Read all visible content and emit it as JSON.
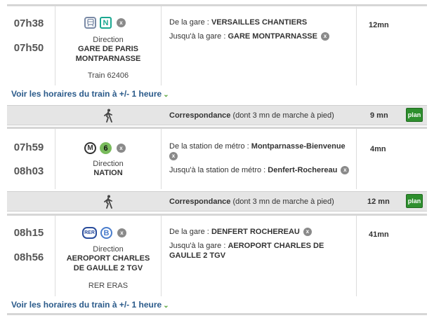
{
  "legs": [
    {
      "depart": "07h38",
      "arrive": "07h50",
      "direction_label": "Direction",
      "direction": "GARE DE PARIS MONTPARNASSE",
      "train_info": "Train 62406",
      "from_prefix": "De la gare :",
      "from": "VERSAILLES CHANTIERS",
      "to_prefix": "Jusqu'à la gare :",
      "to": "GARE MONTPARNASSE",
      "duration": "12mn",
      "line_badge": "N",
      "icons": [
        "train-icon",
        "transilien-n-icon",
        "close-icon"
      ]
    },
    {
      "depart": "07h59",
      "arrive": "08h03",
      "direction_label": "Direction",
      "direction": "NATION",
      "from_prefix": "De la station de métro :",
      "from": "Montparnasse-Bienvenue",
      "to_prefix": "Jusqu'à  la station de métro :",
      "to": "Denfert-Rochereau",
      "duration": "4mn",
      "mode_badge": "M",
      "line_badge": "6",
      "icons": [
        "metro-icon",
        "metro-line-6-icon",
        "close-icon"
      ]
    },
    {
      "depart": "08h15",
      "arrive": "08h56",
      "direction_label": "Direction",
      "direction": "AEROPORT CHARLES DE GAULLE 2 TGV",
      "train_info": "RER ERAS",
      "from_prefix": "De la gare :",
      "from": "DENFERT ROCHEREAU",
      "to_prefix": "Jusqu'à la gare :",
      "to": "AEROPORT CHARLES DE GAULLE 2 TGV",
      "duration": "41mn",
      "mode_badge": "RER",
      "line_badge": "B",
      "icons": [
        "rer-icon",
        "rer-line-b-icon",
        "close-icon"
      ]
    }
  ],
  "transfers": [
    {
      "label_bold": "Correspondance",
      "label_rest": "(dont 3 mn de marche à pied)",
      "duration": "9 mn",
      "plan": "plan"
    },
    {
      "label_bold": "Correspondance",
      "label_rest": "(dont 3 mn de marche à pied)",
      "duration": "12 mn",
      "plan": "plan"
    }
  ],
  "links": {
    "schedule": "Voir les horaires du train à +/- 1 heure",
    "chevron": "⌄"
  },
  "close_glyph": "x",
  "colors": {
    "transilien_n": "#1ba891",
    "metro_6": "#79bb5c",
    "rer_b": "#4a7dcc",
    "plan_button": "#2e8f2e",
    "link": "#2a5a8a"
  }
}
